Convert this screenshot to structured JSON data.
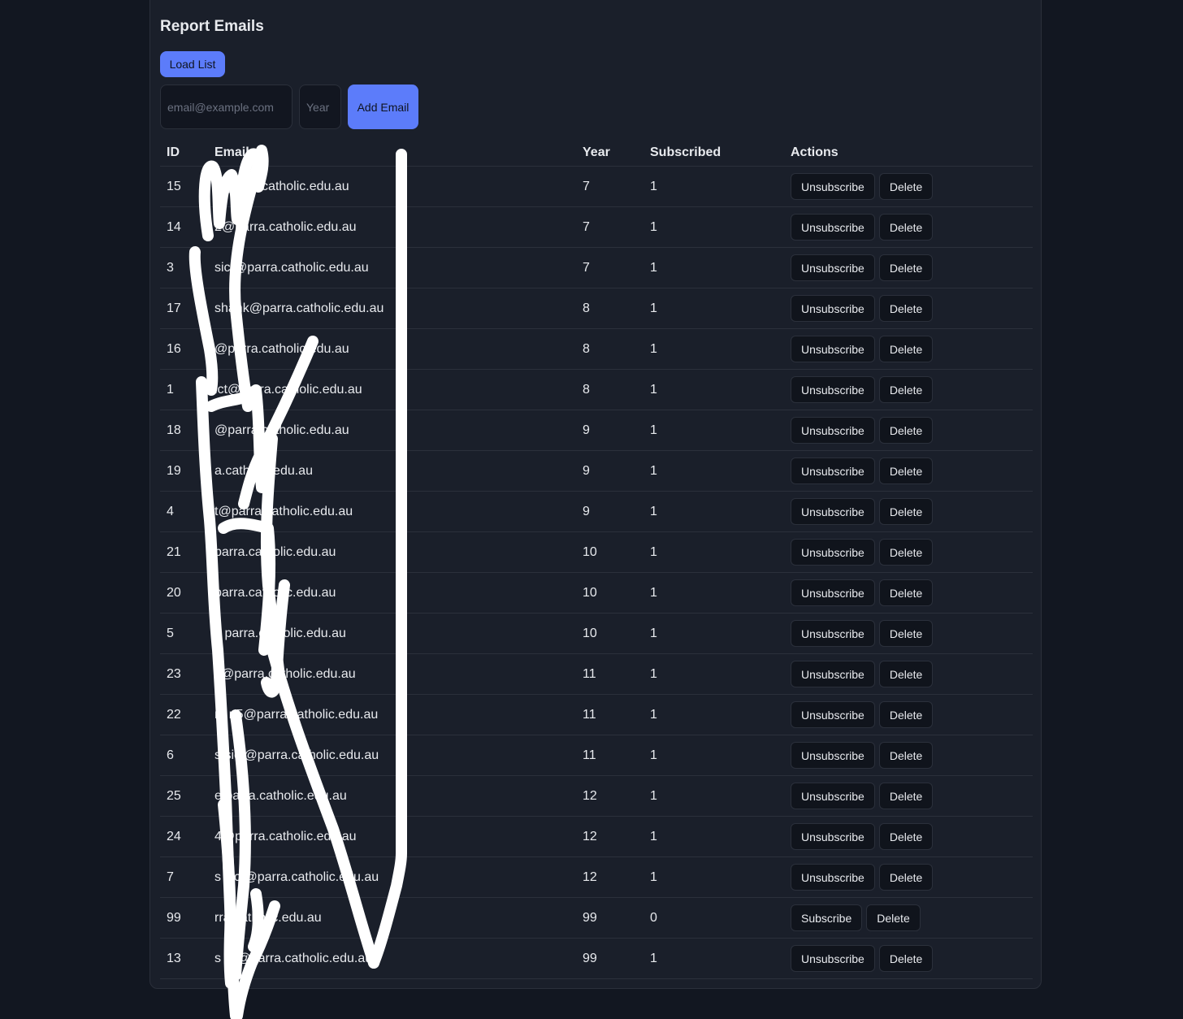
{
  "header": {
    "title": "Report Emails"
  },
  "toolbar": {
    "load_label": "Load List",
    "add_label": "Add Email"
  },
  "form": {
    "email_placeholder": "email@example.com",
    "year_placeholder": "Year"
  },
  "table": {
    "columns": [
      "ID",
      "Email",
      "Year",
      "Subscribed",
      "Actions"
    ],
    "rows": [
      {
        "id": "15",
        "email": "@parra.catholic.edu.au",
        "year": "7",
        "subscribed": "1",
        "toggle": "Unsubscribe",
        "delete": "Delete"
      },
      {
        "id": "14",
        "email": "2@parra.catholic.edu.au",
        "year": "7",
        "subscribed": "1",
        "toggle": "Unsubscribe",
        "delete": "Delete"
      },
      {
        "id": "3",
        "email": "sict@parra.catholic.edu.au",
        "year": "7",
        "subscribed": "1",
        "toggle": "Unsubscribe",
        "delete": "Delete"
      },
      {
        "id": "17",
        "email": "shank@parra.catholic.edu.au",
        "year": "8",
        "subscribed": "1",
        "toggle": "Unsubscribe",
        "delete": "Delete"
      },
      {
        "id": "16",
        "email": "@parra.catholic.edu.au",
        "year": "8",
        "subscribed": "1",
        "toggle": "Unsubscribe",
        "delete": "Delete"
      },
      {
        "id": "1",
        "email": "ict@parra.catholic.edu.au",
        "year": "8",
        "subscribed": "1",
        "toggle": "Unsubscribe",
        "delete": "Delete"
      },
      {
        "id": "18",
        "email": "@parra.catholic.edu.au",
        "year": "9",
        "subscribed": "1",
        "toggle": "Unsubscribe",
        "delete": "Delete"
      },
      {
        "id": "19",
        "email": "a.catholic.edu.au",
        "year": "9",
        "subscribed": "1",
        "toggle": "Unsubscribe",
        "delete": "Delete"
      },
      {
        "id": "4",
        "email": "t@parra.catholic.edu.au",
        "year": "9",
        "subscribed": "1",
        "toggle": "Unsubscribe",
        "delete": "Delete"
      },
      {
        "id": "21",
        "email": "parra.catholic.edu.au",
        "year": "10",
        "subscribed": "1",
        "toggle": "Unsubscribe",
        "delete": "Delete"
      },
      {
        "id": "20",
        "email": "parra.catholic.edu.au",
        "year": "10",
        "subscribed": "1",
        "toggle": "Unsubscribe",
        "delete": "Delete"
      },
      {
        "id": "5",
        "email": "s parra.catholic.edu.au",
        "year": "10",
        "subscribed": "1",
        "toggle": "Unsubscribe",
        "delete": "Delete"
      },
      {
        "id": "23",
        "email": "j @parra.catholic.edu.au",
        "year": "11",
        "subscribed": "1",
        "toggle": "Unsubscribe",
        "delete": "Delete"
      },
      {
        "id": "22",
        "email": "m n5@parra.catholic.edu.au",
        "year": "11",
        "subscribed": "1",
        "toggle": "Unsubscribe",
        "delete": "Delete"
      },
      {
        "id": "6",
        "email": "s sict@parra.catholic.edu.au",
        "year": "11",
        "subscribed": "1",
        "toggle": "Unsubscribe",
        "delete": "Delete"
      },
      {
        "id": "25",
        "email": "e parra.catholic.edu.au",
        "year": "12",
        "subscribed": "1",
        "toggle": "Unsubscribe",
        "delete": "Delete"
      },
      {
        "id": "24",
        "email": "4@parra.catholic.edu.au",
        "year": "12",
        "subscribed": "1",
        "toggle": "Unsubscribe",
        "delete": "Delete"
      },
      {
        "id": "7",
        "email": "s sict@parra.catholic.edu.au",
        "year": "12",
        "subscribed": "1",
        "toggle": "Unsubscribe",
        "delete": "Delete"
      },
      {
        "id": "99",
        "email": "rra.catholic.edu.au",
        "year": "99",
        "subscribed": "0",
        "toggle": "Subscribe",
        "delete": "Delete"
      },
      {
        "id": "13",
        "email": "s ict@parra.catholic.edu.au",
        "year": "99",
        "subscribed": "1",
        "toggle": "Unsubscribe",
        "delete": "Delete"
      }
    ]
  },
  "colors": {
    "accent": "#5c7cfa",
    "background": "#121721",
    "card": "#1a1f2a",
    "scribble": "#ffffff"
  }
}
